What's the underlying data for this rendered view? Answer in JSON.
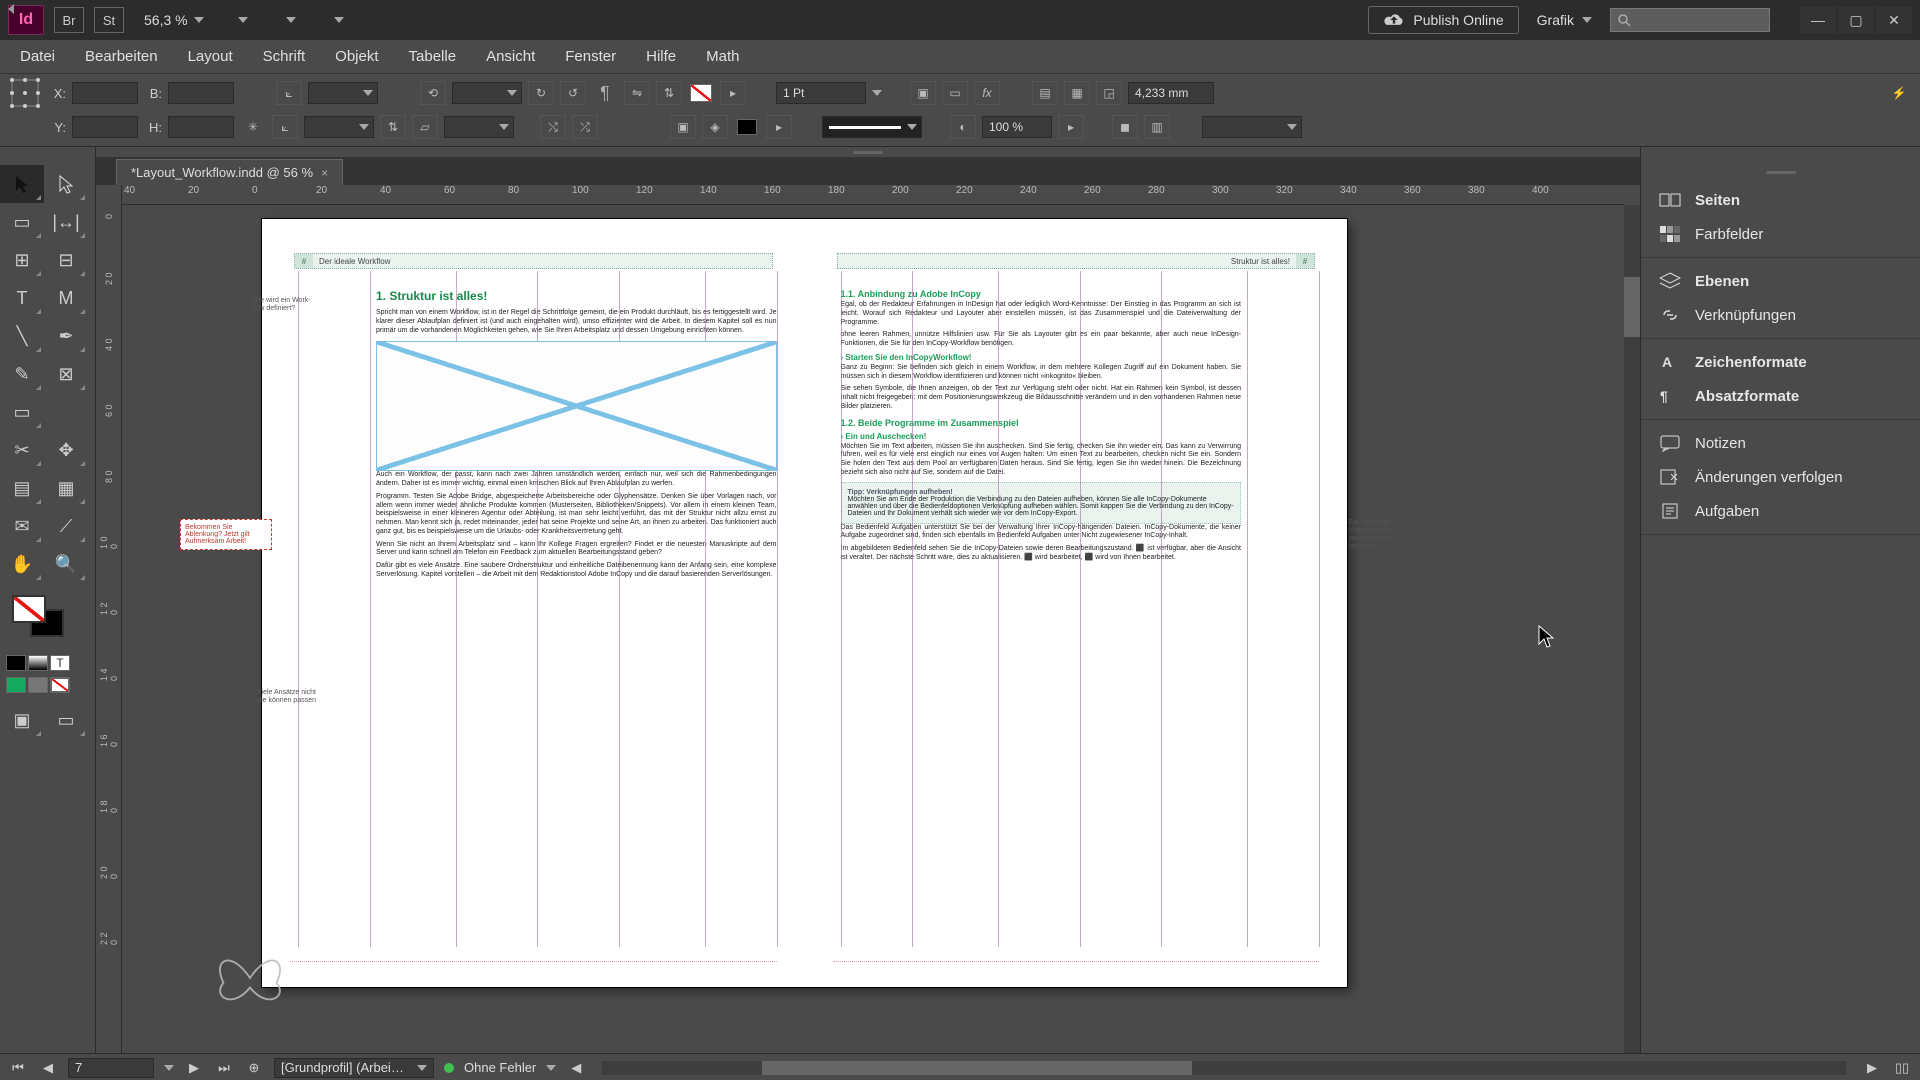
{
  "titlebar": {
    "app_badge": "Id",
    "aux_badges": [
      "Br",
      "St"
    ],
    "zoom_display": "56,3 %",
    "publish_label": "Publish Online",
    "workspace_label": "Grafik"
  },
  "menu": [
    "Datei",
    "Bearbeiten",
    "Layout",
    "Schrift",
    "Objekt",
    "Tabelle",
    "Ansicht",
    "Fenster",
    "Hilfe",
    "Math"
  ],
  "control": {
    "x_label": "X:",
    "y_label": "Y:",
    "w_label": "B:",
    "h_label": "H:",
    "stroke_weight": "1 Pt",
    "opacity": "100 %",
    "gap_value": "4,233 mm"
  },
  "document": {
    "tab_title": "*Layout_Workflow.indd @ 56 %",
    "ruler_h_ticks": [
      "40",
      "20",
      "0",
      "20",
      "40",
      "60",
      "80",
      "100",
      "120",
      "140",
      "160",
      "180",
      "200",
      "220",
      "240",
      "260",
      "280",
      "300",
      "320",
      "340",
      "360",
      "380",
      "400"
    ],
    "ruler_v_ticks": [
      "0",
      "2 0",
      "4 0",
      "6 0",
      "8 0",
      "1 0 0",
      "1 2 0",
      "1 4 0",
      "1 6 0",
      "1 8 0",
      "2 0 0",
      "2 2 0"
    ],
    "left_page": {
      "running_head": "Der ideale Workflow",
      "heading": "1.  Struktur ist alles!",
      "margin_note_top": "Wie wird ein Work-\nflow definiert?",
      "body_1": "Spricht man von einem Workflow, ist in der Regel die Schrittfolge gemeint, die ein Produkt durchläuft, bis es fertiggestellt wird. Je klarer dieser Ablaufplan definiert ist (und auch eingehalten wird), umso effizienter wird die Arbeit. In diesem Kapitel soll es nun primär um die vorhandenen Möglichkeiten gehen, wie Sie Ihren Arbeitsplatz und dessen Umgebung einrichten können.",
      "body_2": "Auch ein Workflow, der passt, kann nach zwei Jahren umständlich werden, einfach nur, weil sich die Rahmenbedingungen ändern. Daher ist es immer wichtig, einmal einen kritischen Blick auf Ihren Ablaufplan zu werfen.",
      "body_3": "Programm. Testen Sie Adobe Bridge, abgespeicherte Arbeitsbereiche oder Glyphensätze. Denken Sie über Vorlagen nach, vor allem wenn immer wieder ähnliche Produkte kommen (Musterseiten, Bibliotheken/Snippets). Vor allem in einem kleinen Team, beispielsweise in einer kleineren Agentur oder Abteilung, ist man sehr leicht verführt, das mit der Struktur nicht allzu ernst zu nehmen. Man kennt sich ja, redet miteinander, jeder hat seine Projekte und seine Art, an ihnen zu arbeiten. Das funktioniert auch ganz gut, bis es beispielsweise um die Urlaubs- oder Krankheitsvertretung geht.",
      "body_4": "Wenn Sie nicht an Ihrem Arbeitsplatz sind – kann Ihr Kollege Fragen ergreifen? Findet er die neuesten Manuskripte auf dem Server und kann schnell am Telefon ein Feedback zum aktuellen Bearbeitungsstand geben?",
      "body_5": "Dafür gibt es viele Ansätze. Eine saubere Ordnerstruktur und einheitliche Dateibenennung kann der Anfang sein, eine komplexe Serverlösung. Kapitel vorstellen – die Arbeit mit dem Redaktionstool Adobe InCopy und die darauf basierenden Serverlösungen.",
      "note_left": "Bekommen Sie Ablenkung? Jetzt gilt Aufmerksam Arbeit!",
      "margin_note_bottom": "Viele Ansätze\nnicht alle können\npassen"
    },
    "right_page": {
      "running_head": "Struktur ist alles!",
      "sub_1": "1.1.  Anbindung zu Adobe InCopy",
      "body_1": "Egal, ob der Redakteur Erfahrungen in InDesign hat oder lediglich Word-Kenntnisse: Der Einstieg in das Programm an sich ist leicht. Worauf sich Redakteur und Layouter aber einstellen müssen, ist das Zusammenspiel und die Dateiverwaltung der Programme.",
      "body_2": "ohne leeren Rahmen, unnütze Hilfslinien usw. Für Sie als Layouter gibt es ein paar bekannte, aber auch neue InDesign-Funktionen, die Sie für den InCopy-Workflow benötigen.",
      "sub2_1": "›  Starten Sie den InCopyWorkflow!",
      "body_3": "Ganz zu Beginn: Sie befinden sich gleich in einem Workflow, in dem mehrere Kollegen Zugriff auf ein Dokument haben. Sie müssen sich in diesem Workflow identifizieren und können nicht »inkognito« bleiben.",
      "body_4": "Sie sehen Symbole, die Ihnen anzeigen, ob der Text zur Verfügung steht oder nicht. Hat ein Rahmen kein Symbol, ist dessen Inhalt nicht freigegeben: mit dem Positionierungswerkzeug die Bildausschnitte verändern und in den vorhandenen Rahmen neue Bilder platzieren.",
      "sub_2": "1.2.  Beide Programme im Zusammenspiel",
      "sub2_2": "›  Ein und Auschecken!",
      "body_5": "Möchten Sie im Text arbeiten, müssen Sie ihn auschecken. Sind Sie fertig, checken Sie ihn wieder ein. Das kann zu Verwirrung führen, weil es für viele erst einglich nur eines vor Augen halten: Um einen Text zu bearbeiten, checken nicht Sie ein. Sondern Sie holen den Text aus dem Pool an verfügbaren Daten heraus. Sind Sie fertig, legen Sie ihn wieder hinein. Die Bezeichnung bezieht sich also nicht auf Sie, sondern auf die Datei.",
      "margin_note_right": "Ein- und Aus-\nchecken nicht\ndurcheinander\nbringen…",
      "tip_title": "Tipp: Verknüpfungen aufheben!",
      "tip_body": "Möchten Sie am Ende der Produktion die Verbindung zu den Dateien aufheben, können Sie alle InCopy-Dokumente anwählen und über die Bedienfeldoptionen Verknüpfung aufheben wählen. Somit kappen Sie die Verbindung zu den InCopy-Dateien und Ihr Dokument verhält sich wieder wie vor dem InCopy-Export.",
      "body_6": "Das Bedienfeld Aufgaben unterstützt Sie bei der Verwaltung Ihrer InCopy-hängenden Dateien. InCopy-Dokumente, die keiner Aufgabe zugeordnet sind, finden sich ebenfalls im Bedienfeld Aufgaben unter Nicht zugewiesener InCopy-Inhalt.",
      "body_7": "Im abgebildeten Bedienfeld sehen Sie die InCopy-Dateien sowie deren Bearbeitungszustand. ⬛ ist verfügbar, aber die Ansicht ist veraltet. Der nächste Schritt wäre, dies zu aktualisieren. ⬛ wird bearbeitet, ⬛ wird von Ihnen bearbeitet."
    }
  },
  "panels": {
    "group1": [
      "Seiten",
      "Farbfelder"
    ],
    "group2": [
      "Ebenen",
      "Verknüpfungen"
    ],
    "group3": [
      "Zeichenformate",
      "Absatzformate"
    ],
    "group4": [
      "Notizen",
      "Änderungen verfolgen",
      "Aufgaben"
    ]
  },
  "statusbar": {
    "page_number": "7",
    "profile": "[Grundprofil] (Arbei…",
    "preflight": "Ohne Fehler"
  }
}
